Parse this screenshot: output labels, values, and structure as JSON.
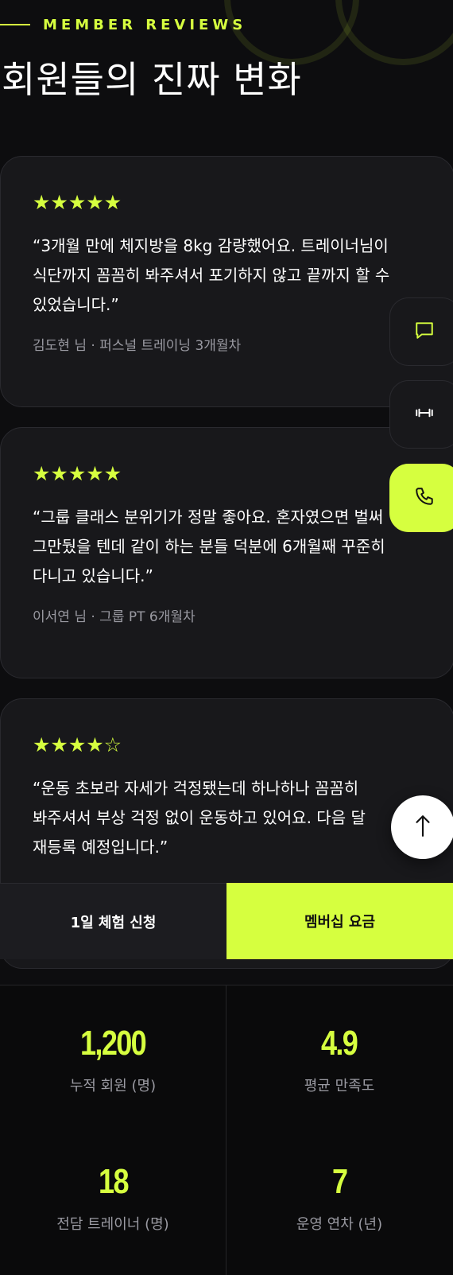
{
  "header": {
    "eyebrow": "MEMBER REVIEWS",
    "title": "회원들의 진짜 변화"
  },
  "reviews": [
    {
      "stars": "★★★★★",
      "rating": 5,
      "quote": "“3개월 만에 체지방을 8kg 감량했어요. 트레이너님이 식단까지 꼼꼼히 봐주셔서 포기하지 않고 끝까지 할 수 있었습니다.”",
      "author": "김도현 님 · 퍼스널 트레이닝 3개월차"
    },
    {
      "stars": "★★★★★",
      "rating": 5,
      "quote": "“그룹 클래스 분위기가 정말 좋아요. 혼자였으면 벌써 그만뒀을 텐데 같이 하는 분들 덕분에 6개월째 꾸준히 다니고 있습니다.”",
      "author": "이서연 님 · 그룹 PT 6개월차"
    },
    {
      "stars": "★★★★☆",
      "rating": 4,
      "quote": "“운동 초보라 자세가 걱정됐는데 하나하나 꼼꼼히 봐주셔서 부상 걱정 없이 운동하고 있어요. 다음 달 재등록 예정입니다.”",
      "author": ""
    }
  ],
  "floating": {
    "icons": [
      "chat-icon",
      "dumbbell-icon",
      "phone-icon",
      "arrow-up-icon"
    ],
    "scroll_top": "↑"
  },
  "cta": {
    "trial_label": "1일 체험 신청",
    "membership_label": "멤버십 요금"
  },
  "stats": [
    {
      "value": "1,200",
      "label": "누적 회원 (명)"
    },
    {
      "value": "4.9",
      "label": "평균 만족도"
    },
    {
      "value": "18",
      "label": "전담 트레이너 (명)"
    },
    {
      "value": "7",
      "label": "운영 연차 (년)"
    }
  ],
  "colors": {
    "accent": "#d6ff3f",
    "background": "#0d0d0f",
    "card": "#18181b",
    "muted_text": "#9a9aa2"
  }
}
